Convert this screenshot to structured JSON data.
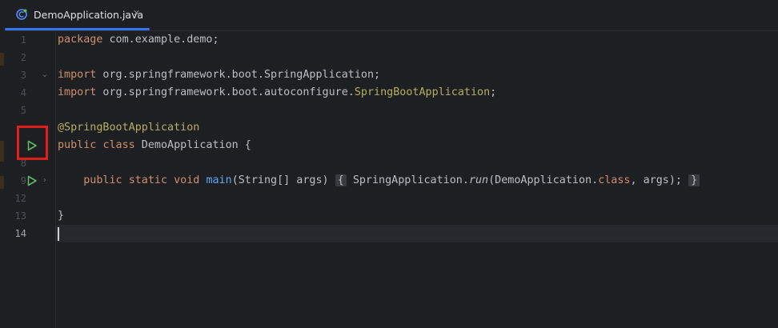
{
  "tab": {
    "label": "DemoApplication.java",
    "close": "✕",
    "icon": "java-class-icon"
  },
  "gutter": {
    "line_numbers": [
      "1",
      "2",
      "3",
      "4",
      "5",
      "",
      "",
      "8",
      "9",
      "12",
      "13",
      "14"
    ],
    "active_line": "14"
  },
  "code": {
    "line1": {
      "kw": "package",
      "rest": " com.example.demo;"
    },
    "line3": {
      "kw": "import",
      "rest": " org.springframework.boot.SpringApplication;"
    },
    "line4": {
      "kw": "import",
      "rest": " org.springframework.boot.autoconfigure.",
      "ann": "SpringBootApplication",
      "end": ";"
    },
    "line6": {
      "ann": "@SpringBootApplication"
    },
    "line7": {
      "kw1": "public",
      "kw2": "class",
      "rest": " DemoApplication {"
    },
    "line9": {
      "kw1": "public",
      "kw2": "static",
      "kw3": "void",
      "fn": "main",
      "params": "(String[] args)",
      "brace_open": "{",
      "body1": "SpringApplication.",
      "call": "run",
      "body2": "(DemoApplication.",
      "kw_class": "class",
      "body3": ", args);",
      "brace_close": "}"
    },
    "line13": {
      "text": "}"
    }
  },
  "colors": {
    "accent": "#3574f0",
    "highlight": "#e01e1e",
    "run_green": "#5fb865"
  }
}
